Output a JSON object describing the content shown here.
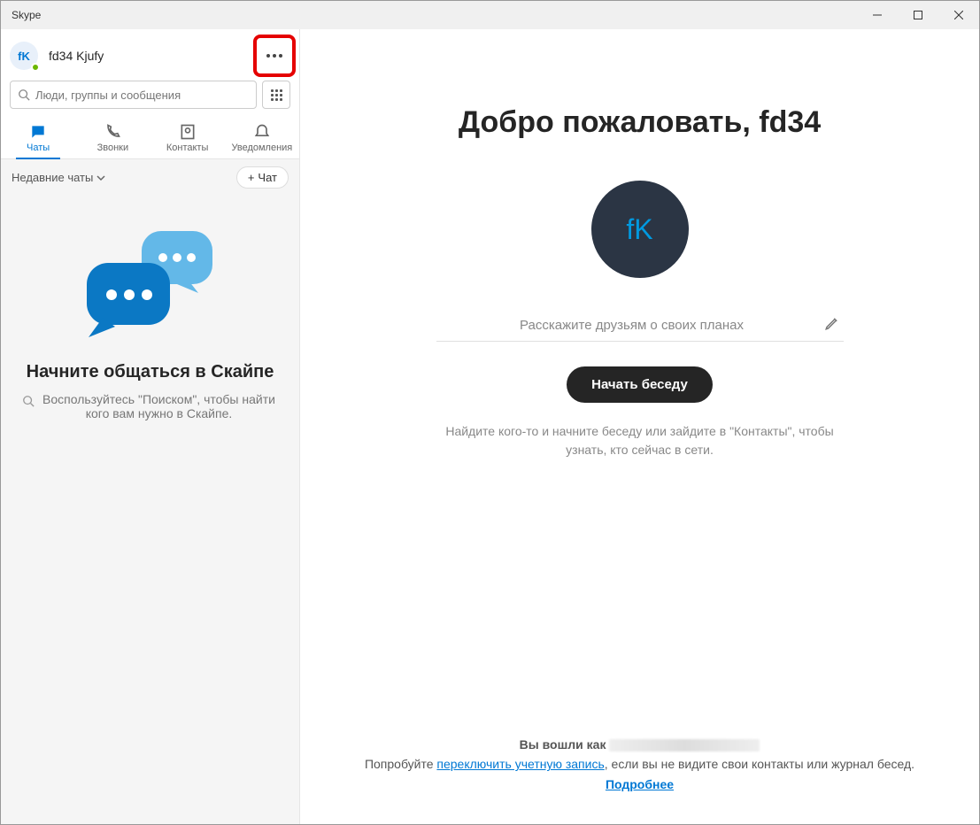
{
  "window": {
    "title": "Skype"
  },
  "profile": {
    "initials": "fK",
    "name": "fd34 Kjufy",
    "big_initials": "fK"
  },
  "search": {
    "placeholder": "Люди, группы и сообщения"
  },
  "tabs": {
    "chats": "Чаты",
    "calls": "Звонки",
    "contacts": "Контакты",
    "notifications": "Уведомления"
  },
  "recent": {
    "label": "Недавние чаты",
    "new_chat": "Чат"
  },
  "empty": {
    "title": "Начните общаться в Скайпе",
    "text": "Воспользуйтесь \"Поиском\", чтобы найти кого вам нужно в Скайпе."
  },
  "main": {
    "welcome": "Добро пожаловать, fd34",
    "status_placeholder": "Расскажите друзьям о своих планах",
    "start_button": "Начать беседу",
    "hint": "Найдите кого-то и начните беседу или зайдите в \"Контакты\", чтобы узнать, кто сейчас в сети."
  },
  "footer": {
    "signed_in_as": "Вы вошли как",
    "try_prefix": "Попробуйте ",
    "switch_account": "переключить учетную запись",
    "try_suffix": ", если вы не видите свои контакты или журнал бесед.",
    "more": "Подробнее"
  }
}
